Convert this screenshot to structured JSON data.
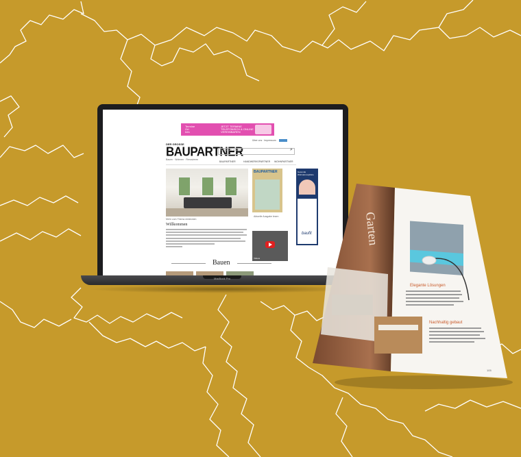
{
  "website": {
    "ad_lines_left": [
      "Termine",
      "Ort",
      "Info"
    ],
    "ad_lines_right": [
      "JETZT TERMINE",
      "TELEFONISCH & ONLINE",
      "VEREINBAREN"
    ],
    "top_links": [
      "Über uns",
      "Impressum"
    ],
    "logo_kicker": "DER GROSSE",
    "logo": "BAUPARTNER",
    "logo_sub": "Bauen · Wohnen · Renovieren",
    "search_placeholder": "Suchbegriff eingeben",
    "nav": [
      "BAUPARTNER",
      "HANDWERKSPARTNER",
      "WOHNPARTNER"
    ],
    "hero_caption": "Mehr zum Thema entdecken",
    "headline": "Willkommen",
    "magazine_caption": "Aktuelle Ausgabe lesen",
    "video_caption": "Videos",
    "skyscraper_text": [
      "Gesunde",
      "Wohnatmosphäre"
    ],
    "skyscraper_brand": "baufit",
    "section_title": "Bauen"
  },
  "laptop": {
    "model": "MacBook Pro"
  },
  "magazine": {
    "left_page_title": "Garten",
    "right_heading_1": "Elegante Lösungen",
    "right_heading_2": "Nachhaltig gebaut",
    "page_number": "105"
  },
  "colors": {
    "background": "#c69a2b",
    "map_lines": "#ffffff",
    "ad": "#e24fb0"
  }
}
